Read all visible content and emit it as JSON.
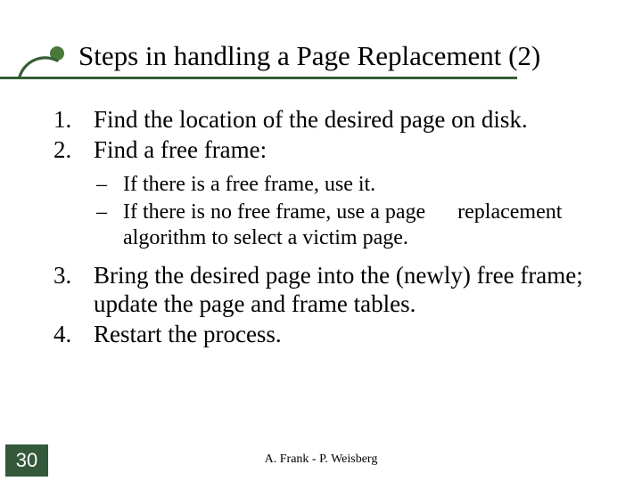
{
  "title": "Steps in handling a Page Replacement (2)",
  "list": {
    "i1n": "1.",
    "i1": "Find the location of the desired page on disk.",
    "i2n": "2.",
    "i2": "Find a free frame:",
    "sub1": "If there is a free frame, use it.",
    "sub2": "If there is no free frame, use a page  replacement algorithm to select a victim page.",
    "i3n": "3.",
    "i3": "Bring the desired page into the (newly) free frame; update the page and frame tables.",
    "i4n": "4.",
    "i4": "Restart the process."
  },
  "dash": "–",
  "page_number": "30",
  "footer": "A. Frank - P. Weisberg",
  "accent_color": "#355e35"
}
